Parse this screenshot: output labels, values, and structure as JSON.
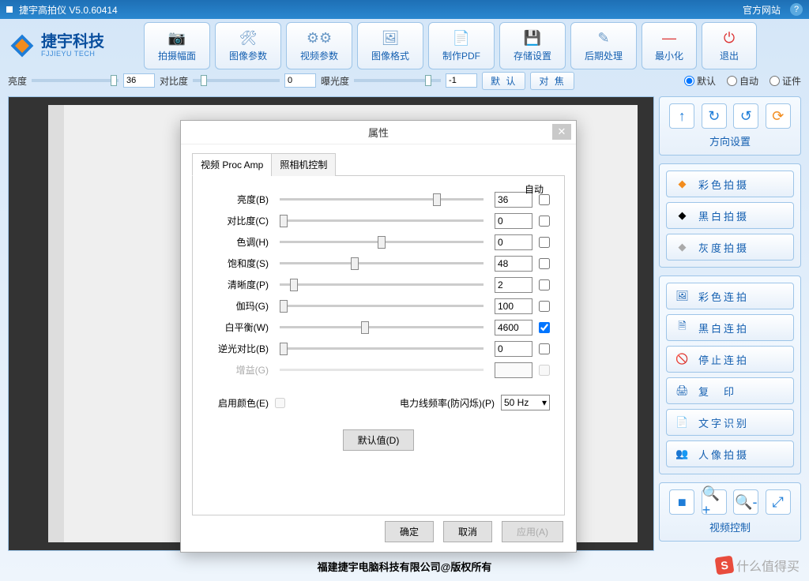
{
  "title_bar": {
    "app_name": "捷宇高拍仪  V5.0.60414",
    "official_site": "官方网站",
    "help": "?"
  },
  "brand": {
    "name": "捷宇科技",
    "sub": "FJJIEYU TECH"
  },
  "toolbar": {
    "capture_area": "拍摄幅面",
    "image_params": "图像参数",
    "video_params": "视频参数",
    "image_format": "图像格式",
    "make_pdf": "制作PDF",
    "storage": "存储设置",
    "post_process": "后期处理",
    "minimize": "最小化",
    "exit": "退出"
  },
  "sliders": {
    "brightness_label": "亮度",
    "brightness_value": "36",
    "contrast_label": "对比度",
    "contrast_value": "0",
    "exposure_label": "曝光度",
    "exposure_value": "-1",
    "default_btn": "默 认",
    "focus_btn": "对 焦"
  },
  "radios": {
    "default": "默认",
    "auto": "自动",
    "cert": "证件"
  },
  "orient": {
    "title": "方向设置"
  },
  "modes": {
    "color_shot": "彩色拍摄",
    "bw_shot": "黑白拍摄",
    "gray_shot": "灰度拍摄",
    "color_burst": "彩色连拍",
    "bw_burst": "黑白连拍",
    "stop_burst": "停止连拍",
    "copy": "复　印",
    "ocr": "文字识别",
    "portrait": "人像拍摄"
  },
  "video_ctrl": {
    "title": "视频控制"
  },
  "footer": "福建捷宇电脑科技有限公司@版权所有",
  "dialog": {
    "title": "属性",
    "tab1": "视频 Proc Amp",
    "tab2": "照相机控制",
    "auto": "自动",
    "rows": {
      "brightness": "亮度(B)",
      "brightness_v": "36",
      "contrast": "对比度(C)",
      "contrast_v": "0",
      "hue": "色调(H)",
      "hue_v": "0",
      "saturation": "饱和度(S)",
      "saturation_v": "48",
      "sharpness": "清晰度(P)",
      "sharpness_v": "2",
      "gamma": "伽玛(G)",
      "gamma_v": "100",
      "whitebalance": "白平衡(W)",
      "whitebalance_v": "4600",
      "backlight": "逆光对比(B)",
      "backlight_v": "0",
      "gain": "增益(G)"
    },
    "enable_color": "启用颜色(E)",
    "freq_label": "电力线频率(防闪烁)(P)",
    "freq_value": "50 Hz",
    "defaults_btn": "默认值(D)",
    "ok": "确定",
    "cancel": "取消",
    "apply": "应用(A)"
  },
  "watermark": "什么值得买"
}
